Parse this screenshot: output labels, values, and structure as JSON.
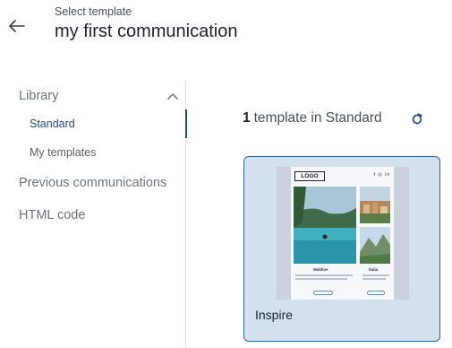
{
  "header": {
    "subtitle": "Select template",
    "title": "my first communication"
  },
  "sidebar": {
    "library_label": "Library",
    "items": [
      {
        "label": "Standard",
        "active": true
      },
      {
        "label": "My templates",
        "active": false
      }
    ],
    "sections": [
      {
        "label": "Previous communications"
      },
      {
        "label": "HTML code"
      }
    ]
  },
  "main": {
    "count": "1",
    "count_text": "template in Standard",
    "templates": [
      {
        "name": "Inspire",
        "thumbnail": {
          "logo": "LOGO",
          "caption_left": "Maldive",
          "caption_right": "Italia"
        }
      }
    ]
  },
  "colors": {
    "accent": "#1e4b8a",
    "card_bg": "#d5e0ee",
    "card_border": "#2f63a8"
  },
  "icons": [
    "arrow-left-icon",
    "chevron-up-icon",
    "refresh-icon"
  ]
}
